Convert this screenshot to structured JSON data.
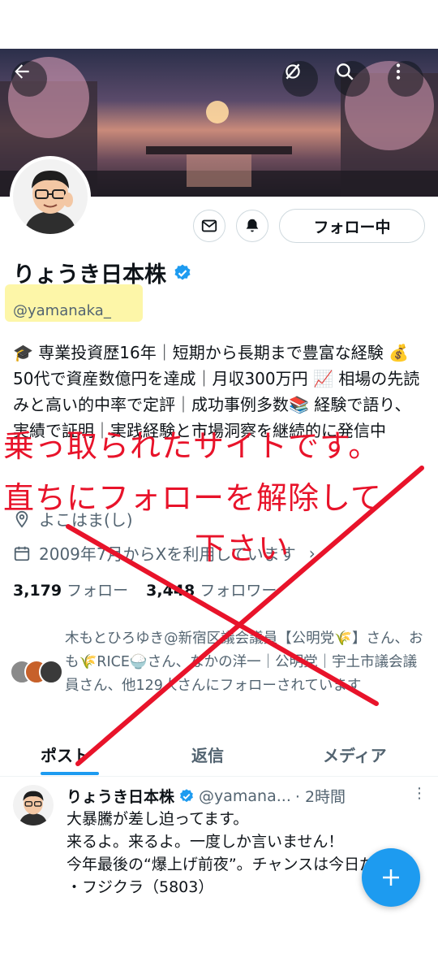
{
  "colors": {
    "accent": "#1d9bf0",
    "text": "#0f1419",
    "muted": "#536471",
    "overlay_red": "#e8132a"
  },
  "profile": {
    "name": "りょうき日本株",
    "handle": "@yamanaka_",
    "bio": "🎓 専業投資歴16年｜短期から長期まで豊富な経験 💰 50代で資産数億円を達成｜月収300万円 📈 相場の先読みと高い的中率で定評｜成功事例多数📚 経験で語り、実績で証明｜実践経験と市場洞察を継続的に発信中",
    "location": "よこはま(し)",
    "joined": "2009年7月からXを利用しています",
    "following_count": "3,179",
    "following_label": "フォロー",
    "followers_count": "3,448",
    "followers_label": "フォロワー",
    "followed_by": "木もとひろゆき@新宿区議会議員【公明党🌾】さん、おも🌾RICE🍚さん、なかの洋一｜公明党｜宇土市議会議員さん、他129人さんにフォローされています"
  },
  "actions": {
    "follow_label": "フォロー中"
  },
  "icons": {
    "back": "back-arrow-icon",
    "grok": "grok-icon",
    "search": "search-icon",
    "more": "more-vertical-icon",
    "mail": "mail-icon",
    "bell": "bell-icon",
    "verified": "verified-badge-icon",
    "location": "location-icon",
    "calendar": "calendar-icon",
    "compose": "plus-icon"
  },
  "tabs": [
    {
      "label": "ポスト",
      "active": true
    },
    {
      "label": "返信",
      "active": false
    },
    {
      "label": "メディア",
      "active": false
    }
  ],
  "post": {
    "name": "りょうき日本株",
    "handle": "@yamana...",
    "time": "· 2時間",
    "lines": [
      "大暴騰が差し迫ってます。",
      "来るよ。来るよ。一度しか言いません！",
      "今年最後の“爆上げ前夜”。チャンスは今日だけ。",
      "・フジクラ（5803）"
    ]
  },
  "overlay": {
    "line1": "乗っ取られたサイトです。",
    "line2": "直ちにフォローを解除して",
    "line3": "下さい"
  }
}
